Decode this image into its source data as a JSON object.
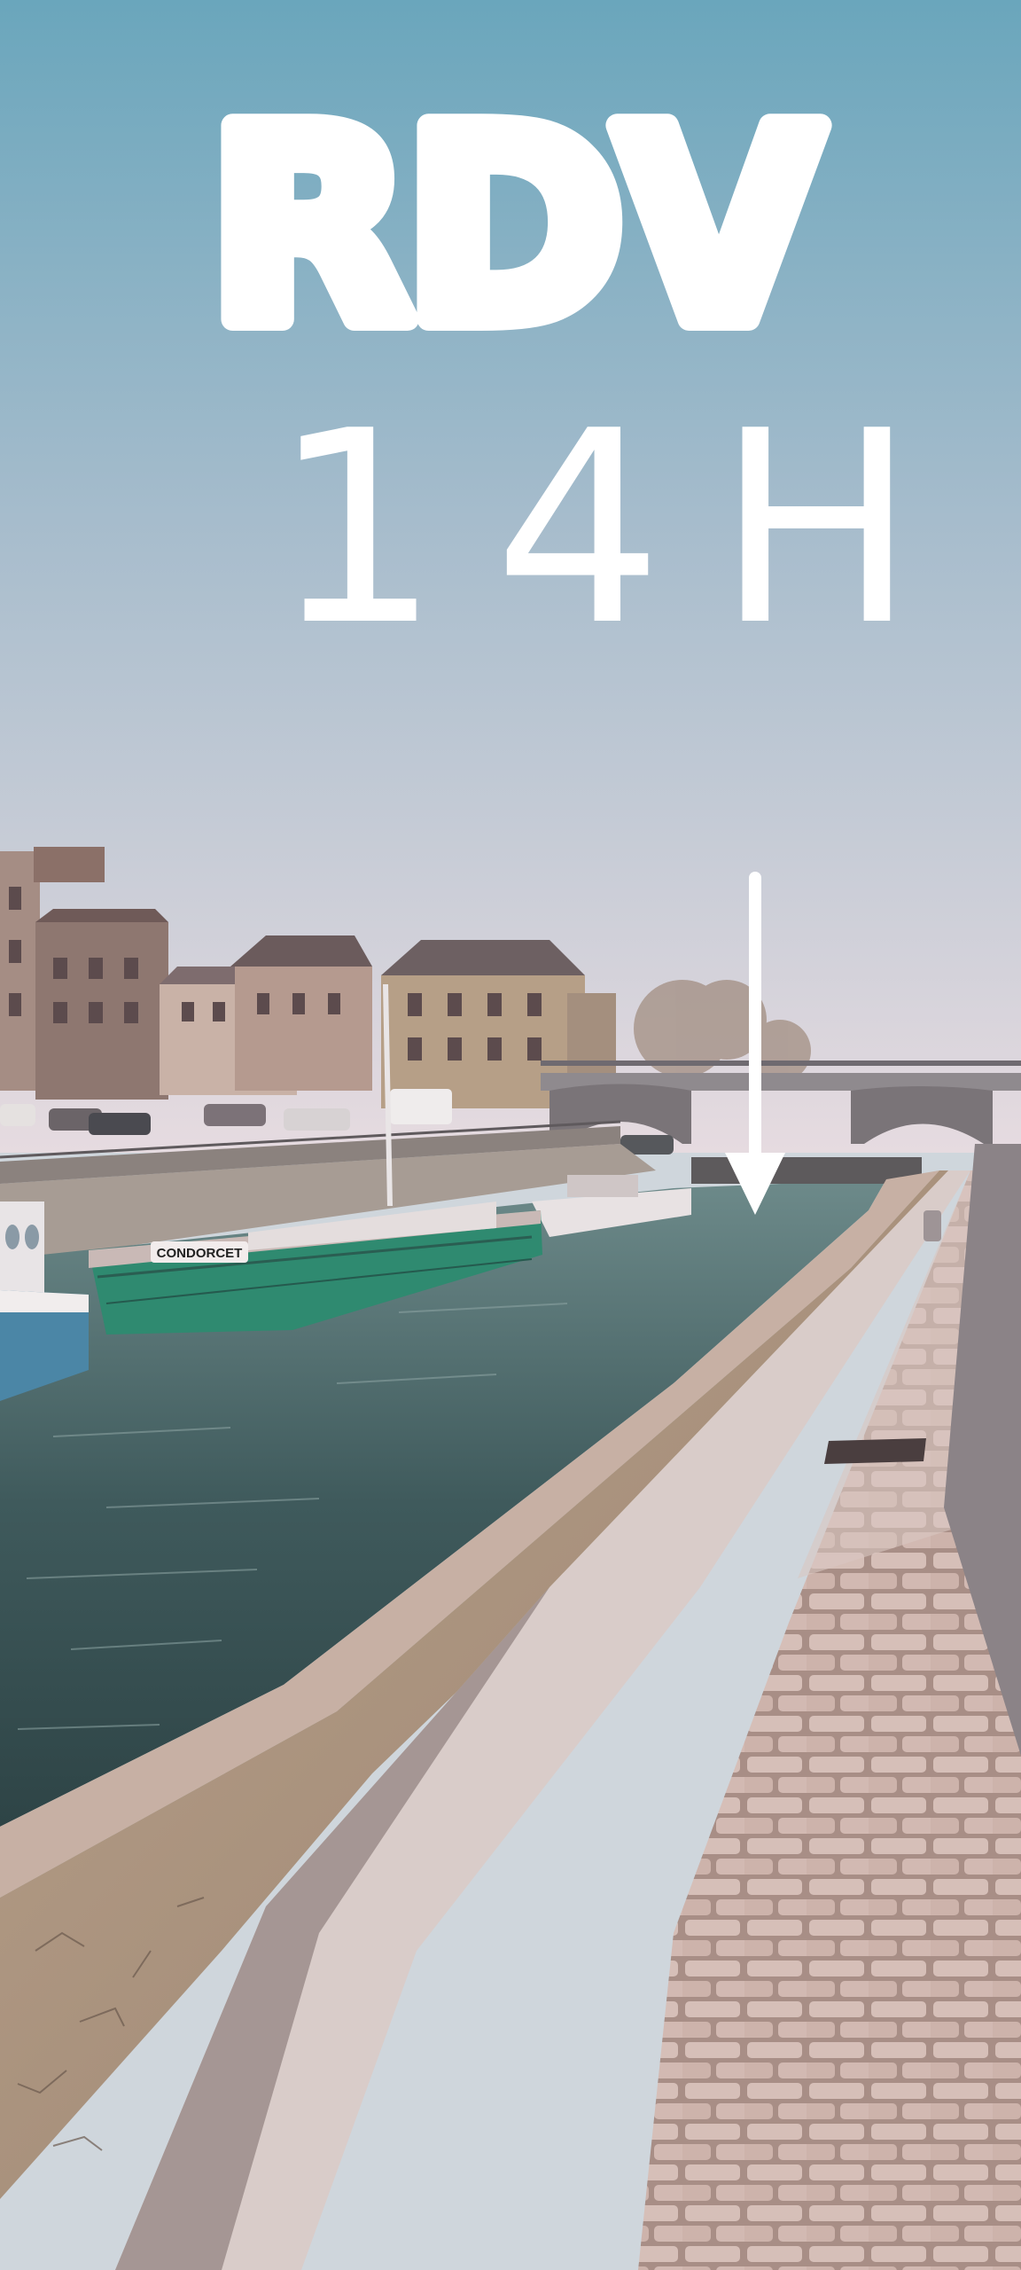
{
  "annotation": {
    "headline": "RDV",
    "time": "14H"
  },
  "boat": {
    "name": "CONDORCET"
  },
  "colors": {
    "sky_top": "#6aa6bc",
    "sky_bottom": "#e6dbe0",
    "water": "#3c555a",
    "hull_green": "#2f8a70",
    "handwriting": "#ffffff",
    "stone_path": "#c9b3ac"
  },
  "icons": {
    "pointer": "arrow-down-icon"
  }
}
